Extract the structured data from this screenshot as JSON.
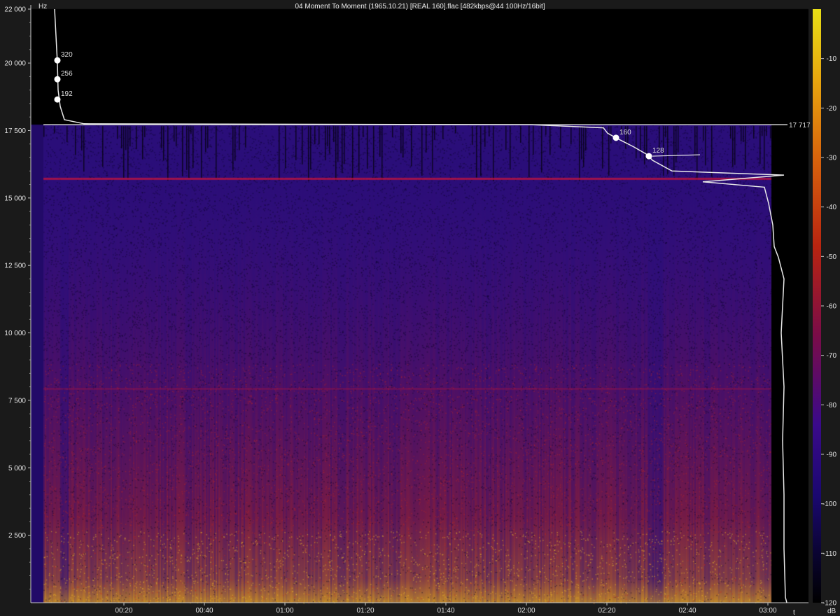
{
  "title": "04 Moment To Moment (1965.10.21) [REAL 160].flac [482kbps@44 100Hz/16bit]",
  "chart_data": {
    "type": "heatmap",
    "y_axis": {
      "unit": "Hz",
      "range": [
        0,
        22000
      ],
      "ticks": [
        "22 000",
        "20 000",
        "17 500",
        "15 000",
        "12 500",
        "10 000",
        "7 500",
        "5 000",
        "2 500"
      ]
    },
    "x_axis": {
      "unit": "t",
      "ticks": [
        "00:20",
        "00:40",
        "01:00",
        "01:20",
        "01:40",
        "02:00",
        "02:20",
        "02:40",
        "03:00"
      ]
    },
    "colorbar": {
      "unit": "dB",
      "range": [
        -120,
        0
      ],
      "ticks": [
        "-10",
        "-20",
        "-30",
        "-40",
        "-50",
        "-60",
        "-70",
        "-80",
        "-90",
        "-100",
        "-110",
        "-120"
      ],
      "colors": [
        "#000000",
        "#1a0870",
        "#3a0a8a",
        "#7a0c48",
        "#b82410",
        "#d8640c",
        "#e8a60e",
        "#e8df16"
      ]
    },
    "cutoff": {
      "frequency_hz": 17717,
      "label": "17 717"
    },
    "bitrate_markers": [
      {
        "label": "320",
        "freq_hz": 20100
      },
      {
        "label": "256",
        "freq_hz": 19400
      },
      {
        "label": "192",
        "freq_hz": 18650
      },
      {
        "label": "160",
        "freq_hz": 17230
      },
      {
        "label": "128",
        "freq_hz": 16550
      }
    ]
  }
}
